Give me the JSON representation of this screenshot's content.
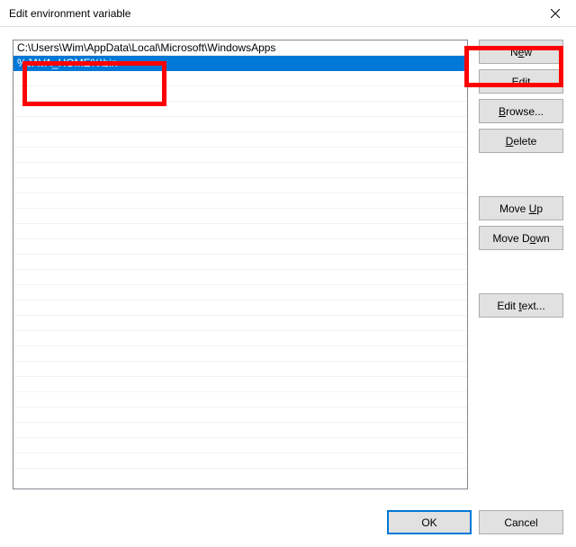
{
  "titlebar": {
    "title": "Edit environment variable"
  },
  "list": {
    "items": [
      {
        "text": "C:\\Users\\Wim\\AppData\\Local\\Microsoft\\WindowsApps",
        "selected": false
      },
      {
        "text": "%JAVA_HOME%\\bin",
        "selected": true
      }
    ]
  },
  "buttons": {
    "new_pre": "N",
    "new_mn": "e",
    "new_post": "w",
    "edit_pre": "",
    "edit_mn": "E",
    "edit_post": "dit",
    "browse_pre": "",
    "browse_mn": "B",
    "browse_post": "rowse...",
    "delete_pre": "",
    "delete_mn": "D",
    "delete_post": "elete",
    "moveup_pre": "Move ",
    "moveup_mn": "U",
    "moveup_post": "p",
    "movedown_pre": "Move D",
    "movedown_mn": "o",
    "movedown_post": "wn",
    "edittext_pre": "Edit ",
    "edittext_mn": "t",
    "edittext_post": "ext...",
    "ok": "OK",
    "cancel": "Cancel"
  }
}
